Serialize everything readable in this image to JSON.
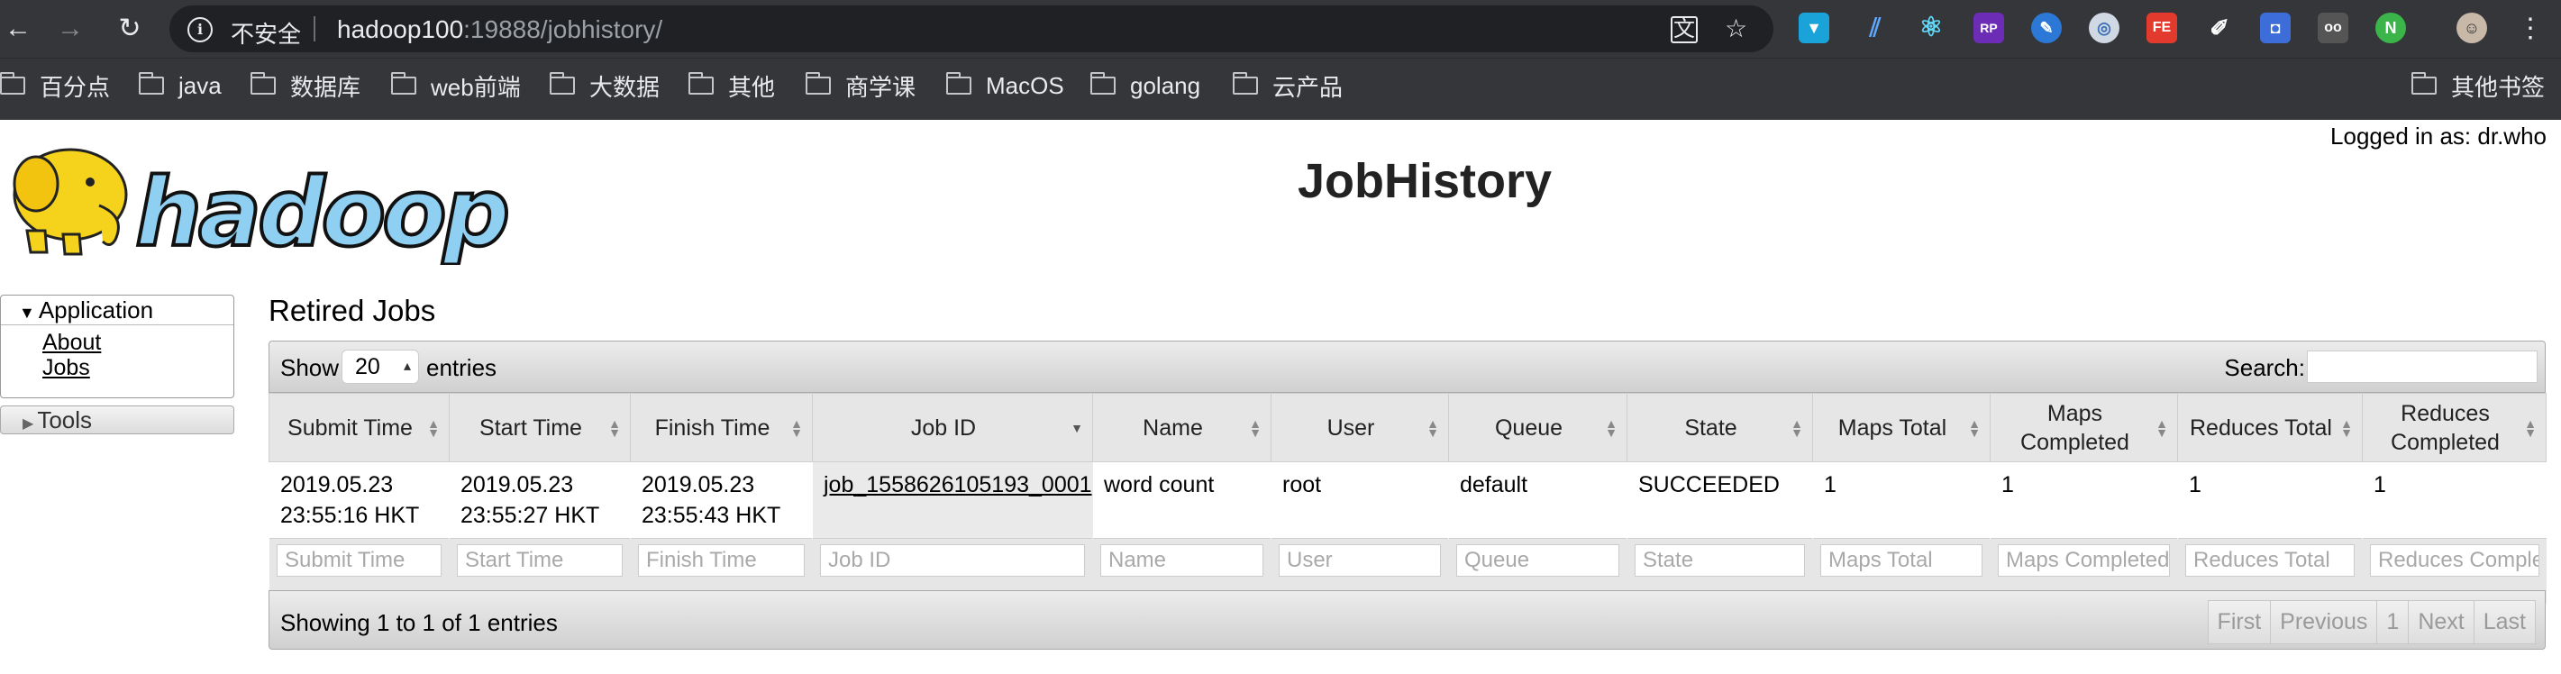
{
  "browser": {
    "insecure_label": "不安全",
    "url_host": "hadoop100",
    "url_rest": ":19888/jobhistory/",
    "bookmarks": [
      "百分点",
      "java",
      "数据库",
      "web前端",
      "大数据",
      "其他",
      "商学课",
      "MacOS",
      "golang",
      "云产品"
    ],
    "other_bookmarks": "其他书签"
  },
  "header": {
    "logged_in": "Logged in as: dr.who",
    "title": "JobHistory",
    "logo_text": "hadoop"
  },
  "sidebar": {
    "application_label": "Application",
    "links": [
      "About",
      "Jobs"
    ],
    "tools_label": "Tools"
  },
  "main": {
    "section_title": "Retired Jobs",
    "show_label": "Show",
    "entries_value": "20",
    "entries_label": "entries",
    "search_label": "Search:",
    "columns": [
      "Submit Time",
      "Start Time",
      "Finish Time",
      "Job ID",
      "Name",
      "User",
      "Queue",
      "State",
      "Maps Total",
      "Maps Completed",
      "Reduces Total",
      "Reduces Completed"
    ],
    "rows": [
      {
        "submit_time": "2019.05.23 23:55:16 HKT",
        "start_time": "2019.05.23 23:55:27 HKT",
        "finish_time": "2019.05.23 23:55:43 HKT",
        "job_id": "job_1558626105193_0001",
        "name": "word count",
        "user": "root",
        "queue": "default",
        "state": "SUCCEEDED",
        "maps_total": "1",
        "maps_completed": "1",
        "reduces_total": "1",
        "reduces_completed": "1"
      }
    ],
    "filter_placeholders": [
      "Submit Time",
      "Start Time",
      "Finish Time",
      "Job ID",
      "Name",
      "User",
      "Queue",
      "State",
      "Maps Total",
      "Maps Completed",
      "Reduces Total",
      "Reduces Completed"
    ],
    "showing_text": "Showing 1 to 1 of 1 entries",
    "pager": [
      "First",
      "Previous",
      "1",
      "Next",
      "Last"
    ]
  }
}
